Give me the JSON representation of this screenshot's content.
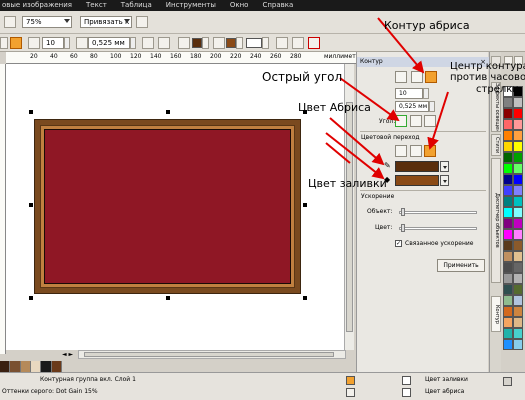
{
  "menu": [
    "овые изображения",
    "Текст",
    "Таблица",
    "Инструменты",
    "Окно",
    "Справка"
  ],
  "toolbar": {
    "zoom_value": "75%",
    "snap_label": "Привязать к",
    "outline_width_field": "10",
    "outline_width_value": "0,525 мм"
  },
  "ruler": {
    "ticks": [
      "20",
      "40",
      "60",
      "80",
      "100",
      "120",
      "140",
      "160",
      "180",
      "200",
      "220",
      "240",
      "260",
      "280"
    ],
    "unit": "миллиметры"
  },
  "docker": {
    "title": "Контур",
    "width_field": "10",
    "width_value": "0,525 мм",
    "corner_label": "Угол:",
    "blend_label": "Цветовой переход",
    "acceleration_label": "Ускорение",
    "object_label": "Объект:",
    "color_label": "Цвет:",
    "linked_label": "Связанное ускорение",
    "apply_button": "Применить"
  },
  "sidetabs": [
    "Контур",
    "Эффекты освещения",
    "Стили",
    "Свойства",
    "Диспетчер объектов"
  ],
  "status": {
    "left_top": "Контурная группа вкл. Слой 1",
    "left_bottom": "Оттенки серого: Dot Gain 15%",
    "fill_label": "Цвет заливки",
    "outline_label": "Цвет абриса"
  },
  "annotations": {
    "contour_outline": "Контур абриса",
    "ccw_center_line1": "Центр контура",
    "ccw_center_line2": "против часовой",
    "ccw_center_line3": "стрелки",
    "sharp_corner": "Острый угол",
    "outline_color": "Цвет Абриса",
    "fill_color": "Цвет заливки"
  },
  "colors": {
    "fill": "#8f1725",
    "frame_dark": "#7a4a1f",
    "frame_light": "#c08040",
    "outline_swatch": "#5a2e0c",
    "fill_swatch": "#8a4a16",
    "arrow": "#e00000"
  },
  "palette_vertical": [
    "#ffffff",
    "#000000",
    "#808080",
    "#c0c0c0",
    "#8b0000",
    "#ff0000",
    "#ff6666",
    "#ff9999",
    "#ff7f00",
    "#ffa040",
    "#ffd700",
    "#ffff00",
    "#006400",
    "#00a000",
    "#00ff00",
    "#66ff66",
    "#00008b",
    "#0000ff",
    "#4040ff",
    "#8080ff",
    "#008080",
    "#00c0c0",
    "#00ffff",
    "#80ffff",
    "#800080",
    "#c000c0",
    "#ff00ff",
    "#ff80ff",
    "#5a3a1a",
    "#8b5a2b",
    "#c09060",
    "#e0c090",
    "#4d4d4d",
    "#666666",
    "#999999",
    "#b3b3b3",
    "#2f4f4f",
    "#556b2f",
    "#8fbc8f",
    "#b0c4de",
    "#d2691e",
    "#cd853f",
    "#f4a460",
    "#deb887",
    "#20b2aa",
    "#48d1cc",
    "#1e90ff",
    "#87ceeb"
  ],
  "palette_bottom": [
    "#3a2010",
    "#7a5030",
    "#b58a5a",
    "#e8d8c0",
    "#1a1a1a",
    "#6a3a1a"
  ]
}
